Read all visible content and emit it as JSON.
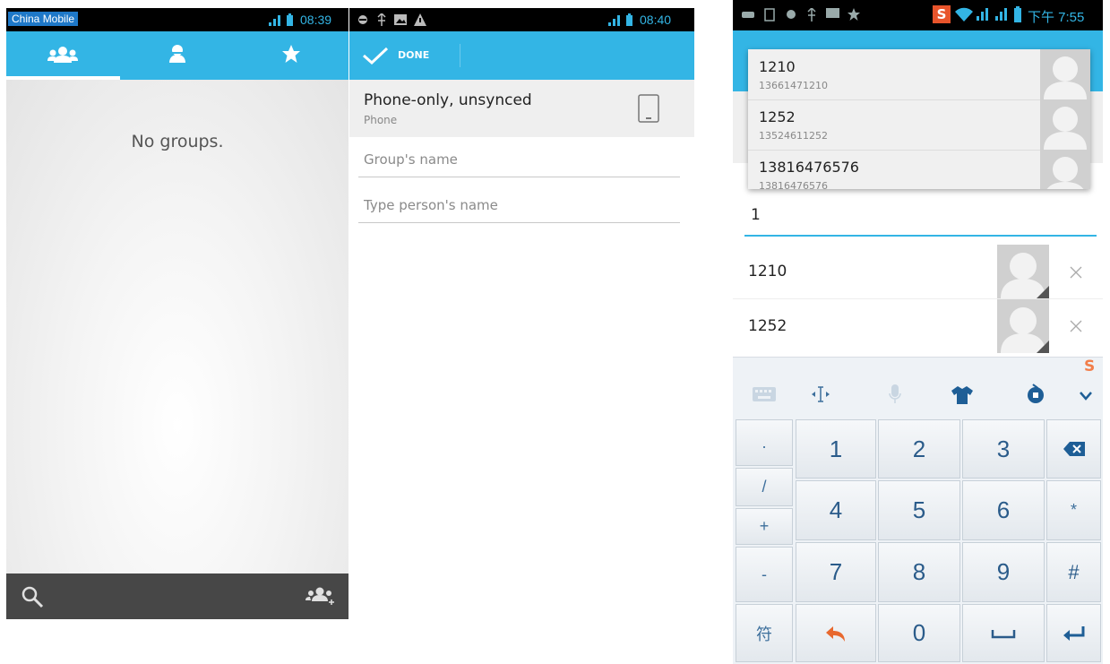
{
  "panel1": {
    "status": {
      "carrier": "China Mobile",
      "time": "08:39"
    },
    "tabs": [
      {
        "name": "groups",
        "icon": "people-icon",
        "selected": true
      },
      {
        "name": "contacts",
        "icon": "person-icon",
        "selected": false
      },
      {
        "name": "favorites",
        "icon": "star-icon",
        "selected": false
      }
    ],
    "empty_message": "No groups.",
    "bottom_bar": {
      "search_icon": "search-icon",
      "add_group_icon": "add-group-icon"
    }
  },
  "panel2": {
    "status": {
      "time": "08:40"
    },
    "done_label": "DONE",
    "account": {
      "title": "Phone-only, unsynced",
      "subtitle": "Phone"
    },
    "group_name_placeholder": "Group's name",
    "person_name_placeholder": "Type person's name"
  },
  "panel3": {
    "status": {
      "time": "下午 7:55"
    },
    "suggestions": [
      {
        "name": "1210",
        "number": "13661471210"
      },
      {
        "name": "1252",
        "number": "13524611252"
      },
      {
        "name": "13816476576",
        "number": "13816476576"
      }
    ],
    "input_value": "1",
    "members": [
      {
        "name": "1210"
      },
      {
        "name": "1252"
      }
    ],
    "keyboard": {
      "toolbar": [
        "keyboard-icon",
        "cursor-icon",
        "mic-icon",
        "shirt-icon",
        "emoji-icon",
        "chevron-down-icon"
      ],
      "side_keys": [
        ".",
        "/",
        "+",
        "-",
        "符"
      ],
      "rows": [
        [
          "1",
          "2",
          "3"
        ],
        [
          "4",
          "5",
          "6"
        ],
        [
          "7",
          "8",
          "9"
        ],
        [
          "",
          "0",
          ""
        ]
      ],
      "right_keys": [
        "",
        "*",
        "#",
        ""
      ]
    }
  }
}
